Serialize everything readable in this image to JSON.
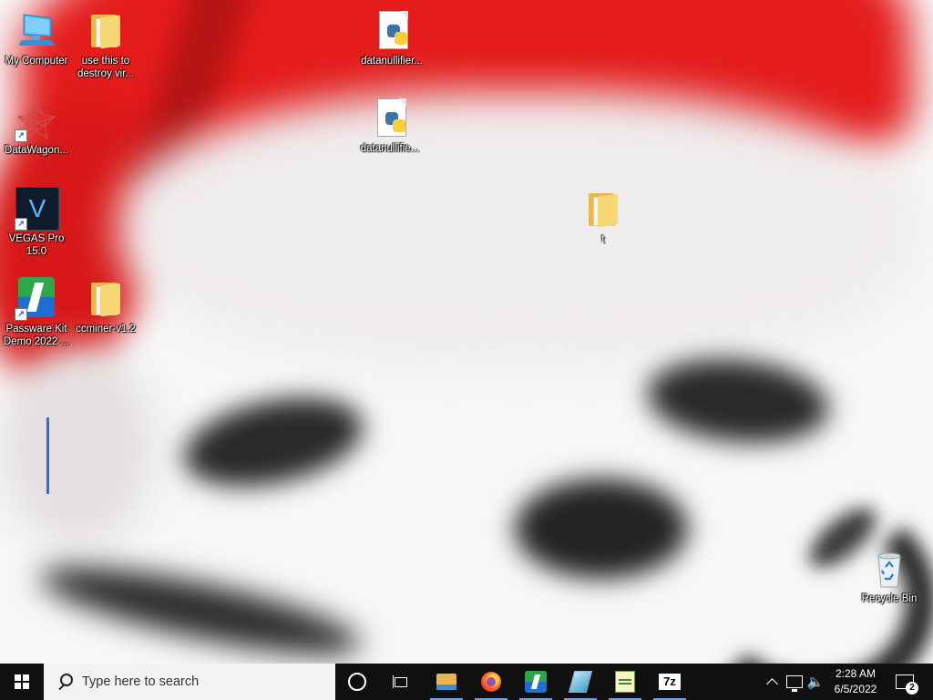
{
  "desktop": {
    "icons": [
      {
        "label": "My Computer",
        "icon": "computer-icon"
      },
      {
        "label": "use this to destroy vir...",
        "icon": "folder-icon"
      },
      {
        "label": "datanullifier...",
        "icon": "python-file-icon"
      },
      {
        "label": "DataWagon...",
        "icon": "datawagon-icon"
      },
      {
        "label": "datanullifie...",
        "icon": "python-file-icon"
      },
      {
        "label": "VEGAS Pro 15.0",
        "icon": "vegas-pro-icon"
      },
      {
        "label": "t",
        "icon": "folder-icon"
      },
      {
        "label": "Passware Kit Demo 2022 ...",
        "icon": "passware-icon"
      },
      {
        "label": "ccminer-v1.2",
        "icon": "folder-icon"
      },
      {
        "label": "Recycle Bin",
        "icon": "recycle-bin-icon"
      }
    ],
    "wallpaper": "santa-hat-wallpaper"
  },
  "taskbar": {
    "search_placeholder": "Type here to search",
    "pinned": [
      {
        "name": "cortana",
        "icon": "cortana-icon"
      },
      {
        "name": "task-view",
        "icon": "task-view-icon"
      },
      {
        "name": "file-explorer",
        "icon": "file-explorer-icon"
      },
      {
        "name": "firefox",
        "icon": "firefox-icon"
      },
      {
        "name": "passware",
        "icon": "passware-icon"
      },
      {
        "name": "glass-app",
        "icon": "glass-app-icon"
      },
      {
        "name": "notepad-plus",
        "icon": "notepad-icon"
      },
      {
        "name": "7zip",
        "icon": "7zip-icon",
        "label": "7z"
      }
    ],
    "zip_label": "7z",
    "clock_time": "2:28 AM",
    "clock_date": "6/5/2022",
    "notification_count": "2"
  },
  "colors": {
    "taskbar": "#101010",
    "accent": "#2f6fd1",
    "hat_red": "#e41c1c"
  }
}
